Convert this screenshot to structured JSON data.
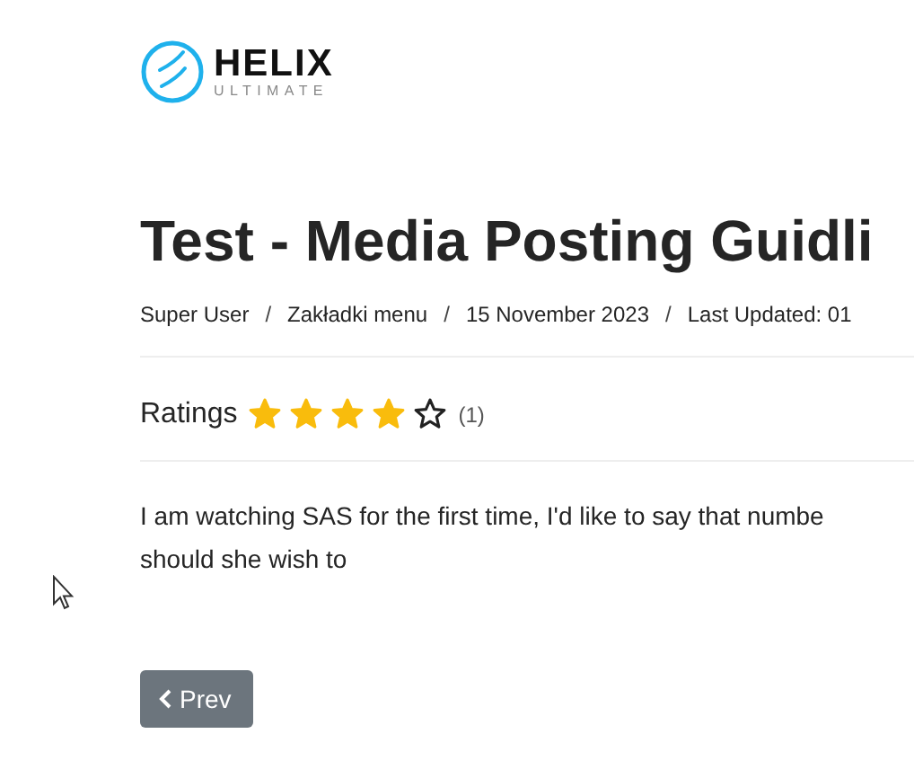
{
  "logo": {
    "name": "HELIX",
    "tagline": "ULTIMATE"
  },
  "article": {
    "title": "Test - Media Posting Guidli",
    "meta": [
      {
        "kind": "item",
        "text": "Super User"
      },
      {
        "kind": "separator",
        "text": "/"
      },
      {
        "kind": "item",
        "text": "Zakładki menu"
      },
      {
        "kind": "separator",
        "text": "/"
      },
      {
        "kind": "item",
        "text": "15 November 2023"
      },
      {
        "kind": "separator",
        "text": "/"
      },
      {
        "kind": "item",
        "text": "Last Updated: 01"
      }
    ],
    "ratings": {
      "label": "Ratings",
      "stars": 4,
      "count": "(1)"
    },
    "body_lines": [
      "I am watching SAS for the first time, I'd like to say that numbe",
      "should she wish to"
    ]
  },
  "pagination": {
    "prev": "Prev"
  }
}
